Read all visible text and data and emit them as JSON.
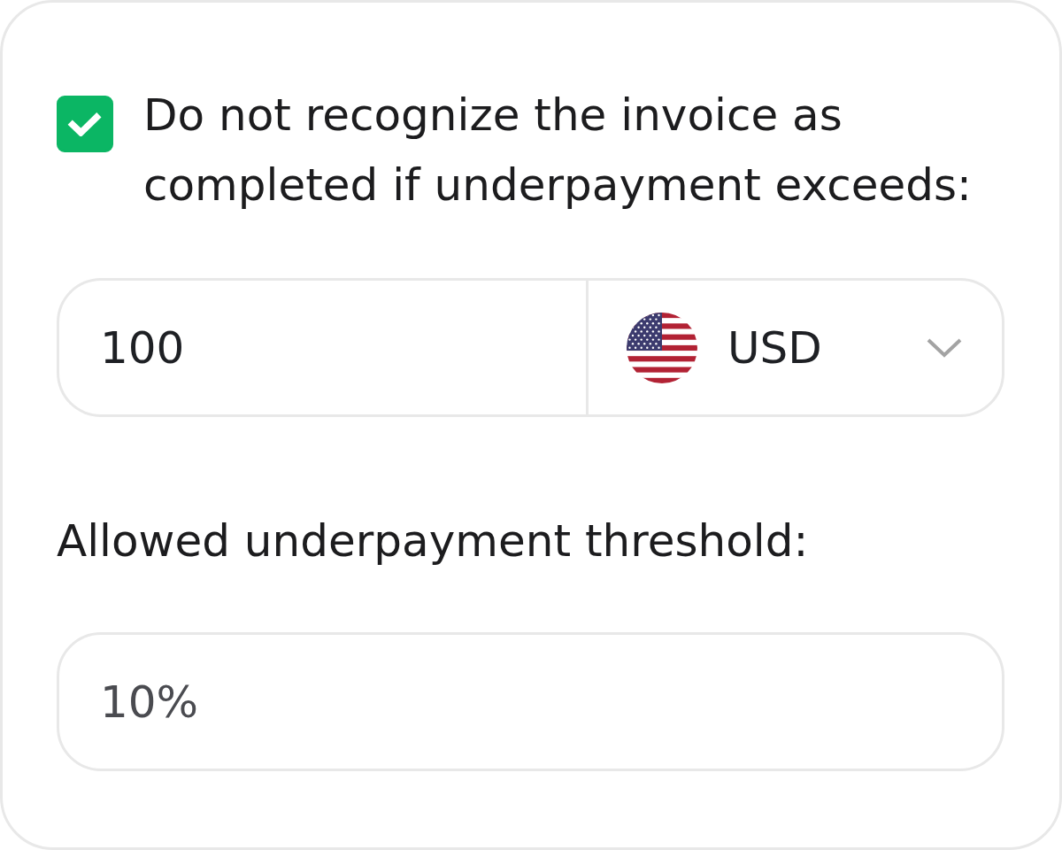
{
  "checkbox": {
    "label": "Do not recognize the invoice as completed if underpayment exceeds:",
    "checked": true
  },
  "amount": {
    "value": "100",
    "currency": "USD"
  },
  "threshold": {
    "label": "Allowed underpayment threshold:",
    "placeholder": "10%"
  }
}
